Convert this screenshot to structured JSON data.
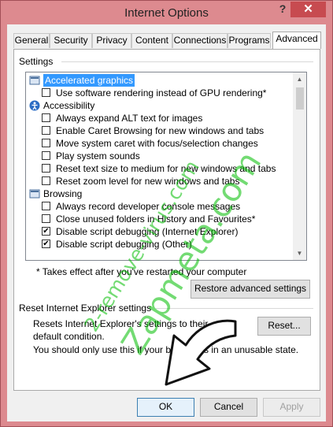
{
  "window": {
    "title": "Internet Options",
    "help": "?",
    "close": "✕"
  },
  "tabs": [
    "General",
    "Security",
    "Privacy",
    "Content",
    "Connections",
    "Programs",
    "Advanced"
  ],
  "settings_group": {
    "label": "Settings"
  },
  "settings_list": [
    {
      "type": "category",
      "label": "Accelerated graphics",
      "selected": true,
      "icon": "display-icon"
    },
    {
      "type": "checkbox",
      "label": "Use software rendering instead of GPU rendering*",
      "checked": false
    },
    {
      "type": "category",
      "label": "Accessibility",
      "icon": "accessibility-icon"
    },
    {
      "type": "checkbox",
      "label": "Always expand ALT text for images",
      "checked": false
    },
    {
      "type": "checkbox",
      "label": "Enable Caret Browsing for new windows and tabs",
      "checked": false
    },
    {
      "type": "checkbox",
      "label": "Move system caret with focus/selection changes",
      "checked": false
    },
    {
      "type": "checkbox",
      "label": "Play system sounds",
      "checked": false
    },
    {
      "type": "checkbox",
      "label": "Reset text size to medium for new windows and tabs",
      "checked": false
    },
    {
      "type": "checkbox",
      "label": "Reset zoom level for new windows and tabs",
      "checked": false
    },
    {
      "type": "category",
      "label": "Browsing",
      "icon": "browsing-icon"
    },
    {
      "type": "checkbox",
      "label": "Always record developer console messages",
      "checked": false
    },
    {
      "type": "checkbox",
      "label": "Close unused folders in History and Favourites*",
      "checked": false
    },
    {
      "type": "checkbox",
      "label": "Disable script debugging (Internet Explorer)",
      "checked": true
    },
    {
      "type": "checkbox",
      "label": "Disable script debugging (Other)",
      "checked": true
    }
  ],
  "note": "* Takes effect after you've restarted your computer",
  "restore_button": "Restore advanced settings",
  "reset_group": {
    "label": "Reset Internet Explorer settings",
    "description": "Resets Internet Explorer's settings to their default condition.",
    "reset_button": "Reset...",
    "warning": "You should only use this if your browser is in an unusable state."
  },
  "footer": {
    "ok": "OK",
    "cancel": "Cancel",
    "apply": "Apply"
  },
  "watermark": {
    "line1": "2-remove-virus.com",
    "line2": "Zapmeta.com"
  },
  "colors": {
    "frame": "#dd8a8f",
    "close": "#c74b50",
    "selection": "#3399ff",
    "watermark": "#00be00"
  }
}
